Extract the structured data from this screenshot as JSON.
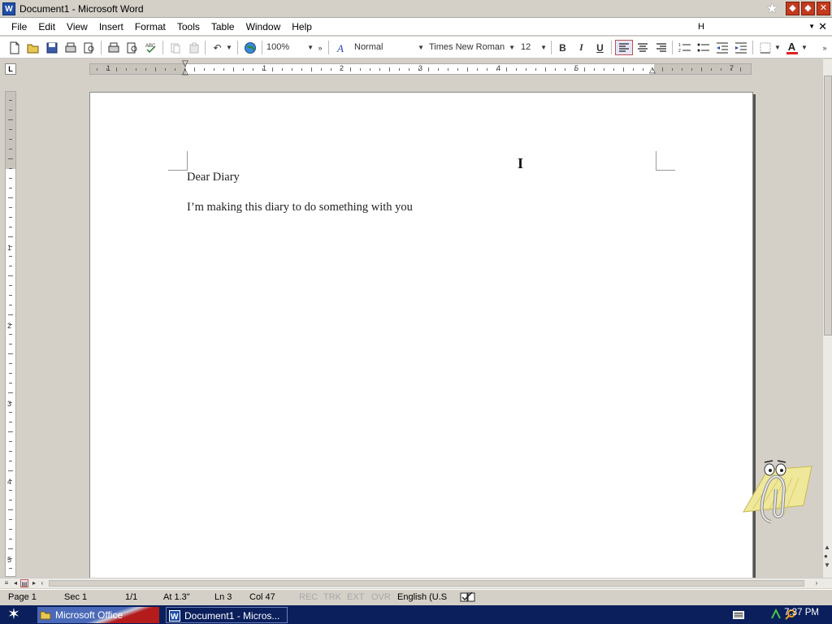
{
  "window": {
    "title": "Document1 - Microsoft Word"
  },
  "menu": [
    "File",
    "Edit",
    "View",
    "Insert",
    "Format",
    "Tools",
    "Table",
    "Window",
    "Help"
  ],
  "help_box": {
    "value": "H"
  },
  "toolbar": {
    "zoom": "100%",
    "style": "Normal",
    "font": "Times New Roman",
    "size": "12",
    "bold": "B",
    "italic": "I",
    "underline": "U",
    "font_color_glyph": "A"
  },
  "ruler": {
    "h_numbers": [
      "1",
      "1",
      "2",
      "3",
      "4",
      "5",
      "7"
    ],
    "v_numbers": [
      "1",
      "2",
      "3",
      "4",
      "5"
    ],
    "tab_marker": "L"
  },
  "document": {
    "lines": [
      "Dear Diary",
      "I’m making this diary to do something with you"
    ]
  },
  "statusbar": {
    "page": "Page  1",
    "sec": "Sec  1",
    "pages": "1/1",
    "at": "At  1.3\"",
    "ln": "Ln  3",
    "col": "Col  47",
    "rec": "REC",
    "trk": "TRK",
    "ext": "EXT",
    "ovr": "OVR",
    "language": "English (U.S"
  },
  "taskbar": {
    "items": [
      "Microsoft Office",
      "Document1 - Micros..."
    ],
    "clock": "7:37 PM"
  },
  "colors": {
    "taskbar": "#0a1f5c",
    "window_buttons": "#c33a1e",
    "font_color_underline": "#e02020"
  },
  "icons": [
    "word-icon",
    "star-icon",
    "minimize-icon",
    "restore-icon",
    "close-icon",
    "new-doc-icon",
    "open-icon",
    "save-icon",
    "permission-icon",
    "print-icon",
    "print-preview-icon",
    "spelling-icon",
    "cut-icon",
    "copy-icon",
    "undo-icon",
    "web-icon",
    "styles-icon",
    "align-left-icon",
    "center-icon",
    "align-right-icon",
    "numbering-icon",
    "bullets-icon",
    "decrease-indent-icon",
    "increase-indent-icon",
    "borders-icon",
    "font-color-icon",
    "office-assistant-icon",
    "start-icon",
    "folder-icon",
    "keyboard-icon",
    "network-icon",
    "search-icon"
  ]
}
